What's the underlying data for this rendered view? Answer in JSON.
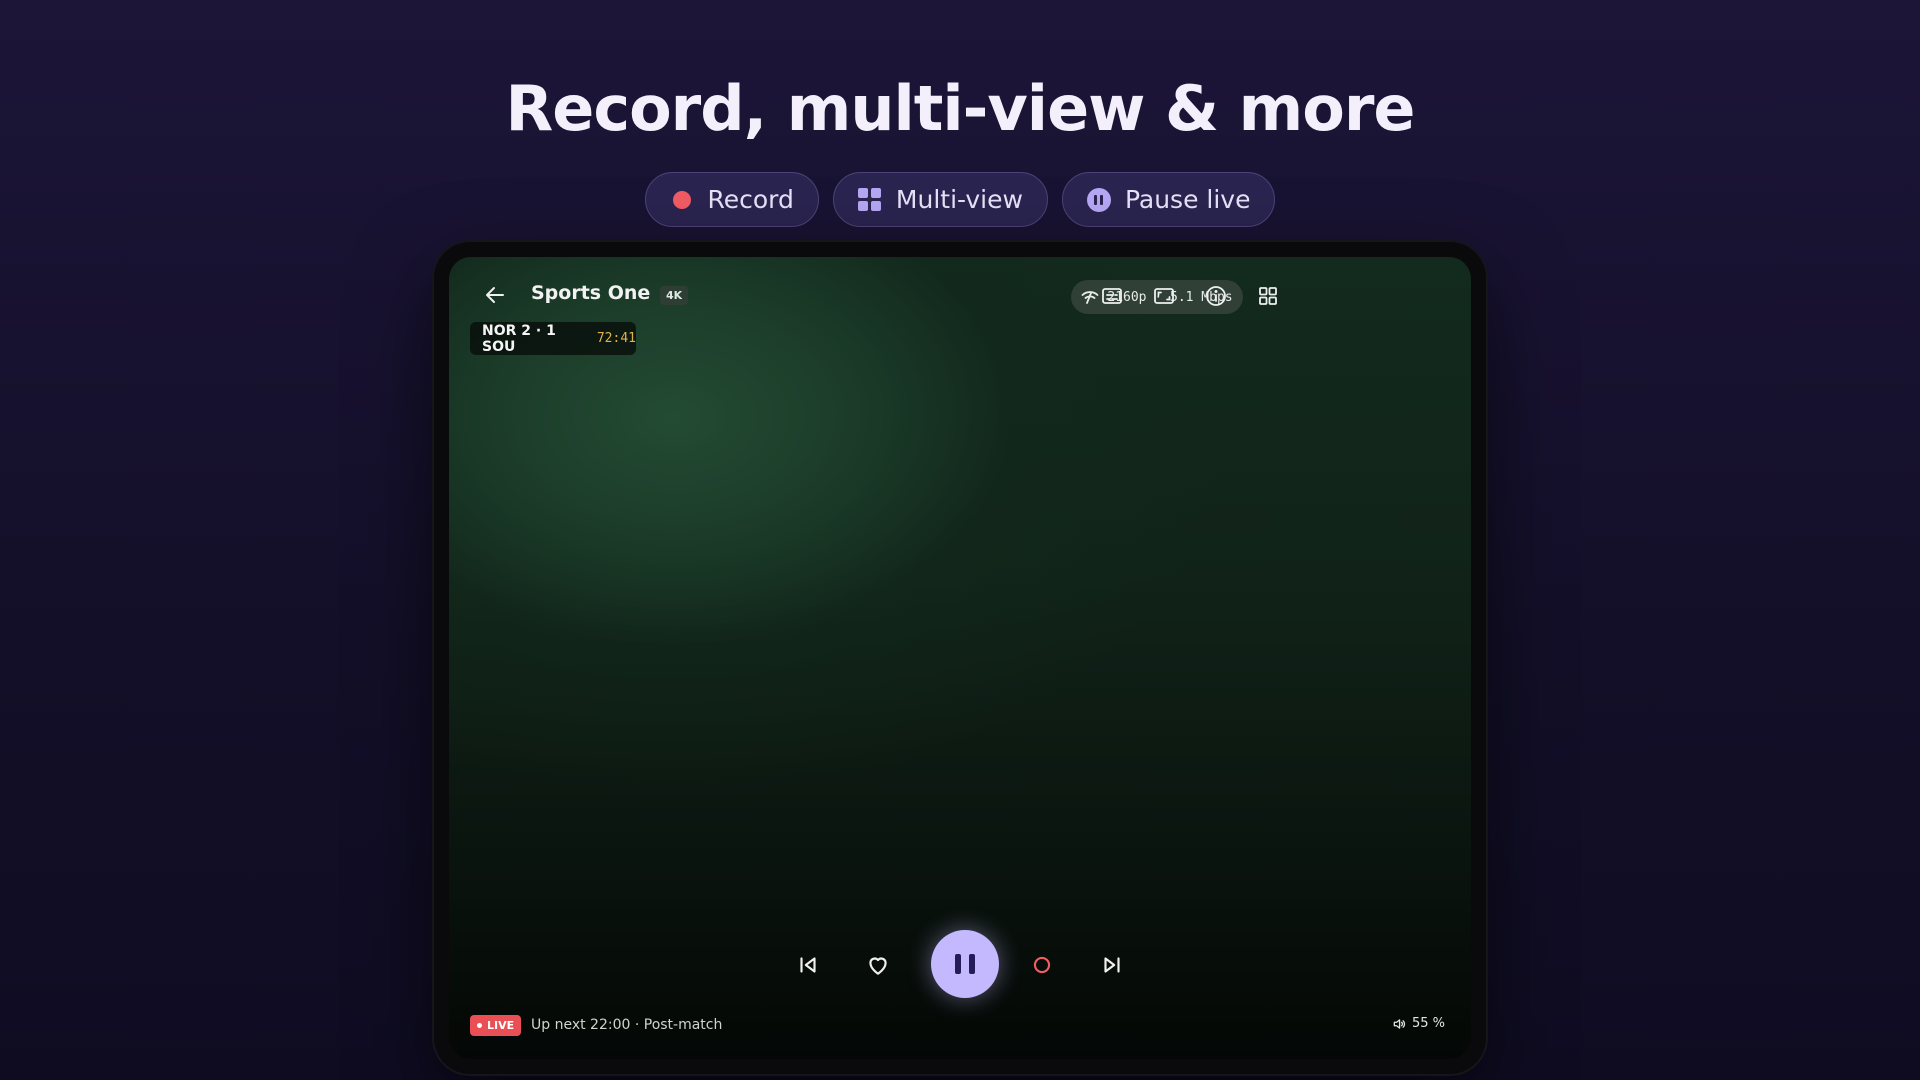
{
  "headline": "Record, multi-view & more",
  "chips": [
    {
      "label": "Record",
      "icon": "record-dot-icon"
    },
    {
      "label": "Multi-view",
      "icon": "grid-icon"
    },
    {
      "label": "Pause live",
      "icon": "pause-circle-icon"
    }
  ],
  "player": {
    "channel": "Sports One",
    "quality_badge": "4K",
    "stream_info": "2160p · 5.1 Mbps",
    "score": "NOR 2 · 1 SOU",
    "match_clock": "72:41",
    "live_label": "LIVE",
    "up_next": "Up next 22:00 · Post-match",
    "volume_percent": 55,
    "volume_text": "55 %"
  },
  "colors": {
    "accent": "#c4b8ff",
    "live_red": "#e94f55",
    "record_red": "#f25c63",
    "clock_amber": "#e2b24a"
  }
}
